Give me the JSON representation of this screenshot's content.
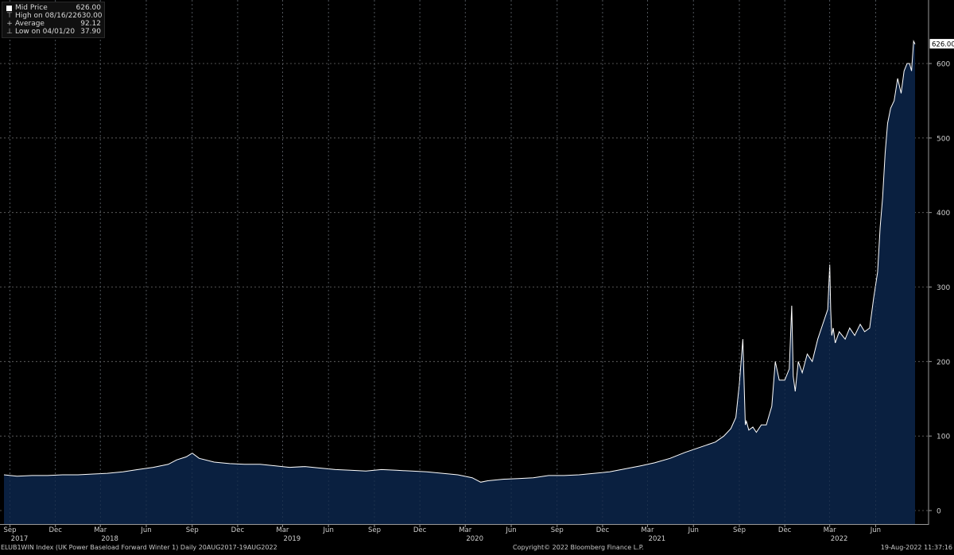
{
  "legend": {
    "series_label": "Mid Price",
    "series_value": "626.00",
    "high_label": "High on 08/16/22",
    "high_value": "630.00",
    "avg_label": "Average",
    "avg_value": "92.12",
    "low_label": "Low on 04/01/20",
    "low_value": "37.90"
  },
  "footer": {
    "left": "ELUB1WIN Index (UK Power Baseload Forward Winter 1)  Daily 20AUG2017-19AUG2022",
    "center": "Copyright© 2022 Bloomberg Finance L.P.",
    "right": "19-Aug-2022 11:37:16"
  },
  "last_value_label": "626.00",
  "colors": {
    "background": "#000000",
    "area_fill": "#0a2040",
    "line": "#ffffff",
    "grid": "#6a6a6a",
    "text": "#cfcfcf"
  },
  "chart_data": {
    "type": "area",
    "ylim": [
      0,
      650
    ],
    "yticks": [
      0,
      100,
      200,
      300,
      400,
      500,
      600
    ],
    "x_month_ticks": [
      "Sep",
      "Dec",
      "Mar",
      "Jun",
      "Sep",
      "Dec",
      "Mar",
      "Jun",
      "Sep",
      "Dec",
      "Mar",
      "Jun",
      "Sep",
      "Dec",
      "Mar",
      "Jun",
      "Sep",
      "Dec",
      "Mar",
      "Jun"
    ],
    "x_year_labels": [
      "2017",
      "2018",
      "2019",
      "2020",
      "2021",
      "2022"
    ],
    "grid": true,
    "series": [
      {
        "name": "Mid Price",
        "x": [
          "2017-08-20",
          "2017-09-15",
          "2017-10-15",
          "2017-11-15",
          "2017-12-15",
          "2018-01-15",
          "2018-02-15",
          "2018-03-15",
          "2018-04-15",
          "2018-05-15",
          "2018-06-15",
          "2018-07-15",
          "2018-08-01",
          "2018-08-20",
          "2018-09-01",
          "2018-09-15",
          "2018-10-15",
          "2018-11-15",
          "2018-12-15",
          "2019-01-15",
          "2019-02-15",
          "2019-03-15",
          "2019-04-15",
          "2019-05-15",
          "2019-06-15",
          "2019-07-15",
          "2019-08-15",
          "2019-09-15",
          "2019-10-15",
          "2019-11-15",
          "2019-12-15",
          "2020-01-15",
          "2020-02-15",
          "2020-03-15",
          "2020-04-01",
          "2020-04-15",
          "2020-05-15",
          "2020-06-15",
          "2020-07-15",
          "2020-08-15",
          "2020-09-15",
          "2020-10-15",
          "2020-11-15",
          "2020-12-15",
          "2021-01-15",
          "2021-02-15",
          "2021-03-15",
          "2021-04-15",
          "2021-05-15",
          "2021-06-15",
          "2021-07-15",
          "2021-08-01",
          "2021-08-15",
          "2021-08-25",
          "2021-09-01",
          "2021-09-08",
          "2021-09-13",
          "2021-09-15",
          "2021-09-20",
          "2021-09-28",
          "2021-10-05",
          "2021-10-15",
          "2021-10-25",
          "2021-11-05",
          "2021-11-12",
          "2021-11-20",
          "2021-12-01",
          "2021-12-10",
          "2021-12-15",
          "2021-12-18",
          "2021-12-22",
          "2021-12-28",
          "2022-01-05",
          "2022-01-15",
          "2022-01-25",
          "2022-02-05",
          "2022-02-15",
          "2022-02-25",
          "2022-03-01",
          "2022-03-03",
          "2022-03-05",
          "2022-03-08",
          "2022-03-12",
          "2022-03-20",
          "2022-04-01",
          "2022-04-10",
          "2022-04-20",
          "2022-05-01",
          "2022-05-10",
          "2022-05-20",
          "2022-05-28",
          "2022-06-05",
          "2022-06-10",
          "2022-06-15",
          "2022-06-20",
          "2022-06-25",
          "2022-07-01",
          "2022-07-08",
          "2022-07-15",
          "2022-07-22",
          "2022-07-28",
          "2022-08-03",
          "2022-08-08",
          "2022-08-12",
          "2022-08-16",
          "2022-08-19"
        ],
        "values": [
          48,
          46,
          47,
          47,
          48,
          48,
          49,
          50,
          52,
          55,
          58,
          62,
          68,
          72,
          77,
          70,
          65,
          63,
          62,
          62,
          60,
          58,
          59,
          57,
          55,
          54,
          53,
          55,
          54,
          53,
          52,
          50,
          48,
          44,
          38,
          40,
          42,
          43,
          44,
          47,
          47,
          48,
          50,
          52,
          56,
          60,
          64,
          70,
          78,
          85,
          92,
          100,
          110,
          125,
          170,
          230,
          115,
          120,
          108,
          112,
          105,
          115,
          115,
          140,
          200,
          175,
          175,
          190,
          275,
          180,
          160,
          200,
          185,
          210,
          200,
          230,
          250,
          270,
          330,
          270,
          235,
          245,
          225,
          240,
          230,
          245,
          235,
          250,
          240,
          245,
          285,
          320,
          380,
          420,
          480,
          520,
          540,
          550,
          580,
          560,
          590,
          600,
          600,
          590,
          630,
          626
        ]
      }
    ]
  }
}
